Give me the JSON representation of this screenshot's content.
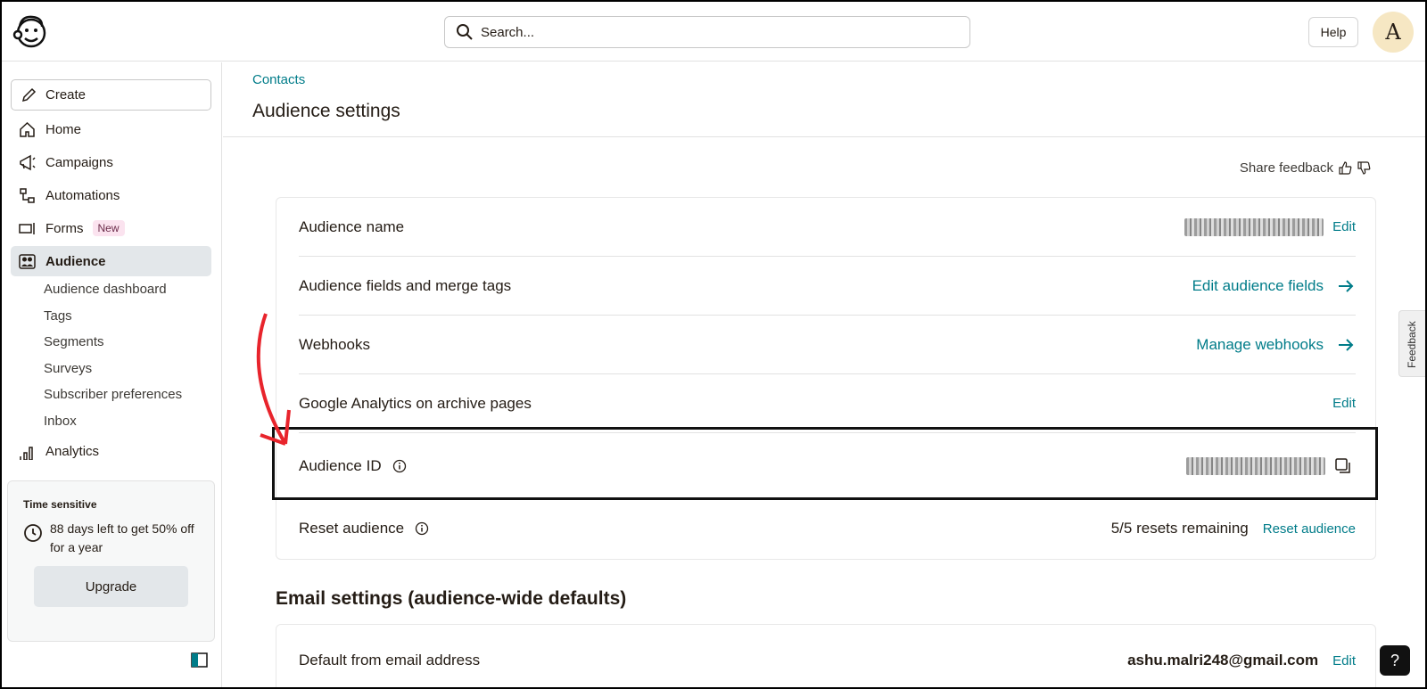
{
  "header": {
    "search_placeholder": "Search...",
    "help_label": "Help",
    "avatar_initial": "A"
  },
  "sidebar": {
    "create_label": "Create",
    "items": [
      {
        "label": "Home",
        "icon": "home-icon"
      },
      {
        "label": "Campaigns",
        "icon": "megaphone-icon"
      },
      {
        "label": "Automations",
        "icon": "automation-icon"
      },
      {
        "label": "Forms",
        "icon": "forms-icon",
        "badge": "New"
      },
      {
        "label": "Audience",
        "icon": "audience-icon",
        "active": true
      }
    ],
    "sub_items": [
      "Audience dashboard",
      "Tags",
      "Segments",
      "Surveys",
      "Subscriber preferences",
      "Inbox"
    ],
    "analytics_label": "Analytics",
    "promo": {
      "title": "Time sensitive",
      "text": "88 days left to get 50% off for a year",
      "button": "Upgrade"
    }
  },
  "main": {
    "breadcrumb": "Contacts",
    "title": "Audience settings",
    "share_feedback": "Share feedback",
    "rows": {
      "audience_name": {
        "label": "Audience name",
        "action": "Edit"
      },
      "merge_tags": {
        "label": "Audience fields and merge tags",
        "action": "Edit audience fields"
      },
      "webhooks": {
        "label": "Webhooks",
        "action": "Manage webhooks"
      },
      "google_analytics": {
        "label": "Google Analytics on archive pages",
        "action": "Edit"
      },
      "audience_id": {
        "label": "Audience ID"
      },
      "reset": {
        "label": "Reset audience",
        "status": "5/5 resets remaining",
        "action": "Reset audience"
      }
    },
    "email_section_title": "Email settings (audience-wide defaults)",
    "email_row": {
      "label": "Default from email address",
      "value": "ashu.malri248@gmail.com",
      "action": "Edit"
    }
  },
  "feedback_tab": "Feedback",
  "help_fab": "?",
  "colors": {
    "accent": "#007c89",
    "active_bg": "#e3e7ea",
    "annotation": "#e8242c"
  }
}
